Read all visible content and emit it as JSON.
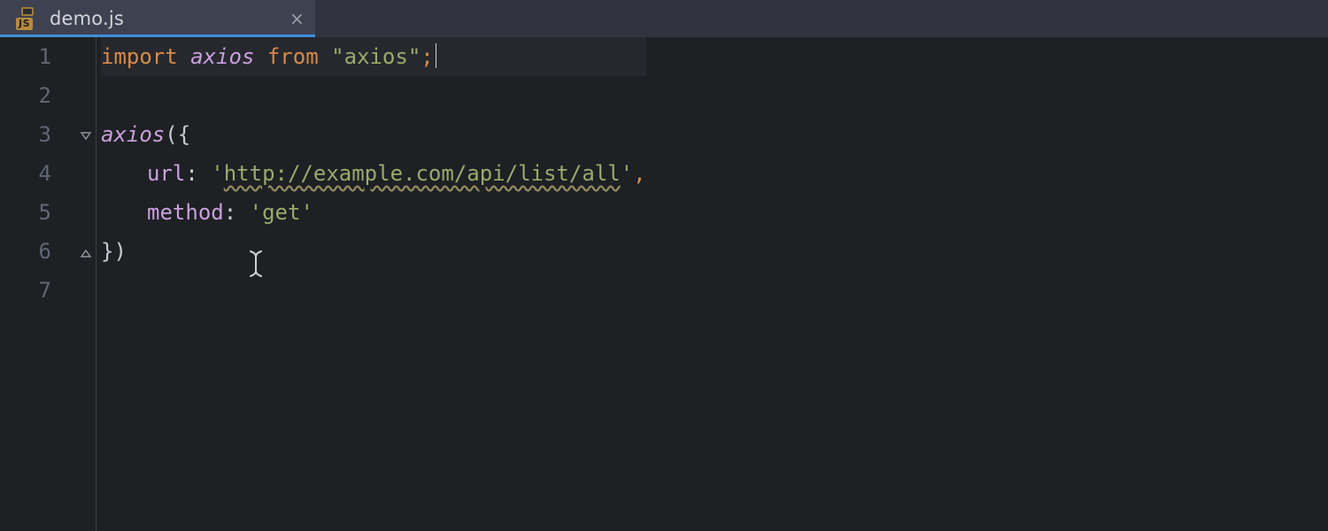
{
  "tab": {
    "filename": "demo.js",
    "icon_label": "JS",
    "close_glyph": "×"
  },
  "gutter": {
    "lines": [
      "1",
      "2",
      "3",
      "4",
      "5",
      "6",
      "7"
    ]
  },
  "code": {
    "l1": {
      "kw_import": "import ",
      "ident": "axios",
      "kw_from": " from ",
      "q1": "\"",
      "mod": "axios",
      "q2": "\"",
      "semi": ";"
    },
    "l3": {
      "ident": "axios",
      "open": "({"
    },
    "l4": {
      "prop": "url",
      "colon": ": ",
      "q1": "'",
      "url": "http://example.com/api/list/all",
      "q2": "'",
      "comma": ","
    },
    "l5": {
      "prop": "method",
      "colon": ": ",
      "q1": "'",
      "val": "get",
      "q2": "'"
    },
    "l6": {
      "close": "})"
    }
  },
  "colors": {
    "bg": "#1e2024",
    "tabbar": "#313440",
    "tab_active": "#3e4250",
    "accent": "#3f8fd9",
    "keyword": "#d78b49",
    "identifier": "#c9a0dd",
    "string": "#99aa6c",
    "gutter": "#616772"
  }
}
